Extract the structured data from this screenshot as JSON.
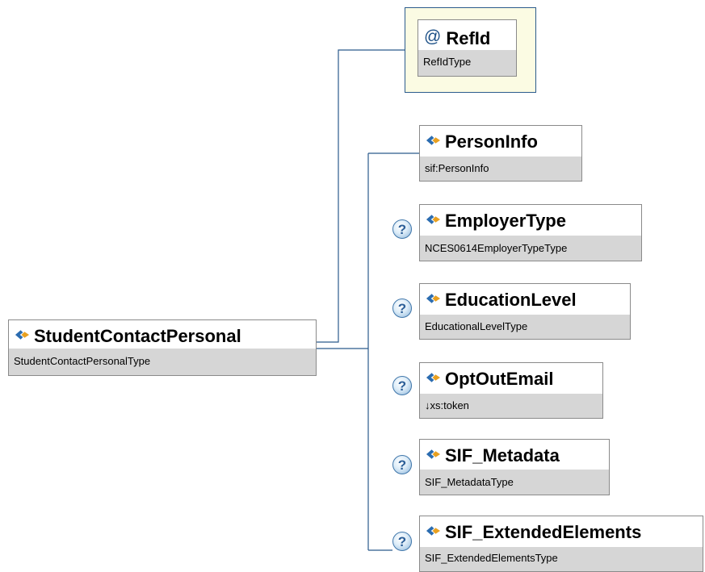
{
  "root": {
    "name": "StudentContactPersonal",
    "type": "StudentContactPersonalType"
  },
  "attribute": {
    "name": "RefId",
    "type": "RefIdType"
  },
  "elements": [
    {
      "name": "PersonInfo",
      "type": "sif:PersonInfo",
      "optional": false
    },
    {
      "name": "EmployerType",
      "type": "NCES0614EmployerTypeType",
      "optional": true
    },
    {
      "name": "EducationLevel",
      "type": "EducationalLevelType",
      "optional": true
    },
    {
      "name": "OptOutEmail",
      "type": "↓xs:token",
      "optional": true
    },
    {
      "name": "SIF_Metadata",
      "type": "SIF_MetadataType",
      "optional": true
    },
    {
      "name": "SIF_ExtendedElements",
      "type": "SIF_ExtendedElementsType",
      "optional": true
    }
  ],
  "optional_marker": "?",
  "colors": {
    "connector": "#2b5b8c",
    "type_band": "#d6d6d6",
    "attribute_bg": "#fbfbe3"
  }
}
